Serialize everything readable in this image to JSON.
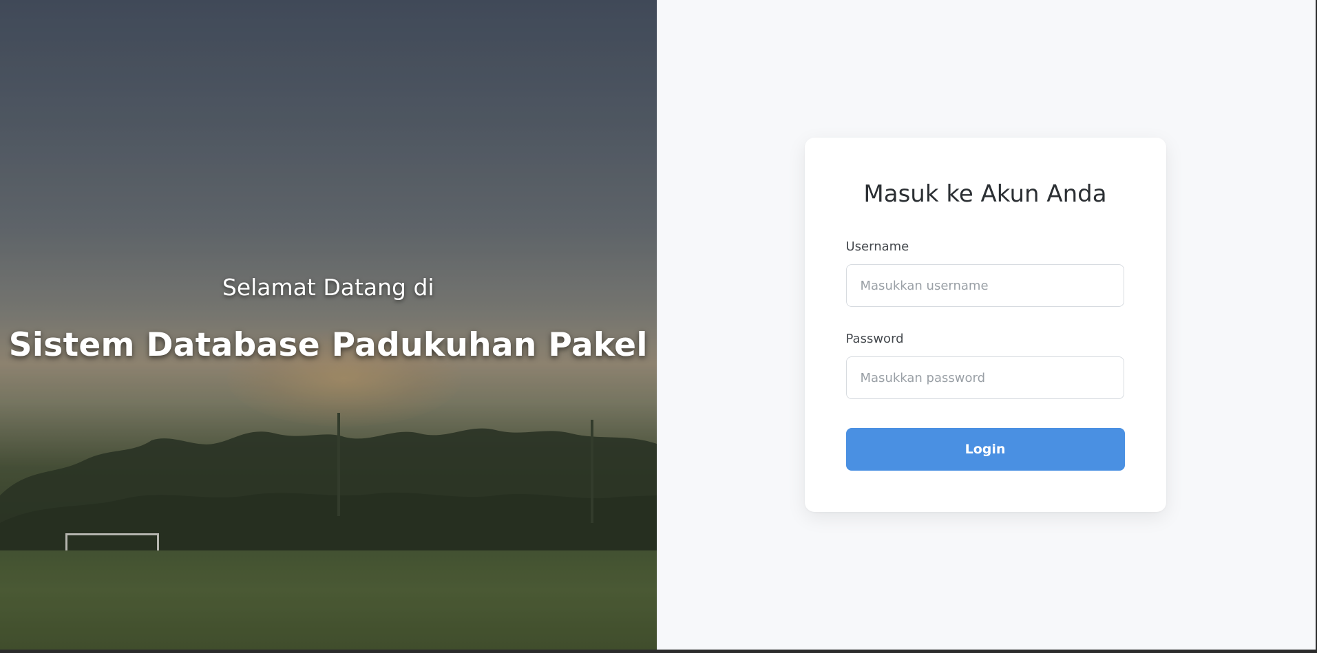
{
  "hero": {
    "subtitle": "Selamat Datang di",
    "title": "Sistem Database Padukuhan Pakel"
  },
  "login": {
    "heading": "Masuk ke Akun Anda",
    "username_label": "Username",
    "username_placeholder": "Masukkan username",
    "username_value": "",
    "password_label": "Password",
    "password_placeholder": "Masukkan password",
    "password_value": "",
    "button_label": "Login"
  },
  "colors": {
    "accent": "#4a90e2",
    "background": "#f7f8fa",
    "card": "#ffffff"
  }
}
